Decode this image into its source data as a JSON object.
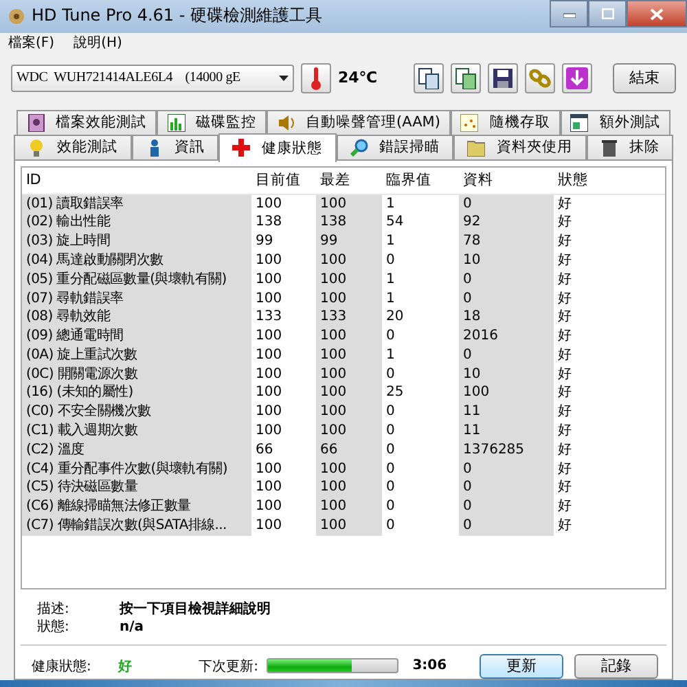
{
  "window": {
    "title": "HD Tune Pro 4.61 - 硬碟檢測維護工具"
  },
  "menu": [
    "檔案(F)",
    "說明(H)"
  ],
  "toolbar": {
    "drive": "WDC  WUH721414ALE6L4    (14000 gE",
    "temperature": "24℃",
    "exit_button": "結束"
  },
  "tab_rows": [
    [
      {
        "label": "檔案效能測試",
        "selected": false
      },
      {
        "label": "磁碟監控",
        "selected": false
      },
      {
        "label": "自動噪聲管理(AAM)",
        "selected": false
      },
      {
        "label": "隨機存取",
        "selected": false
      },
      {
        "label": "額外測試",
        "selected": false
      }
    ],
    [
      {
        "label": "效能測試",
        "selected": false
      },
      {
        "label": "資訊",
        "selected": false
      },
      {
        "label": "健康狀態",
        "selected": true
      },
      {
        "label": "錯誤掃瞄",
        "selected": false
      },
      {
        "label": "資料夾使用",
        "selected": false
      },
      {
        "label": "抹除",
        "selected": false
      }
    ]
  ],
  "table": {
    "columns": [
      "ID",
      "目前值",
      "最差",
      "臨界值",
      "資料",
      "狀態"
    ],
    "rows": [
      [
        "(01) 讀取錯誤率",
        "100",
        "100",
        "1",
        "0",
        "好"
      ],
      [
        "(02) 輸出性能",
        "138",
        "138",
        "54",
        "92",
        "好"
      ],
      [
        "(03) 旋上時間",
        "99",
        "99",
        "1",
        "78",
        "好"
      ],
      [
        "(04) 馬達啟動關閉次數",
        "100",
        "100",
        "0",
        "10",
        "好"
      ],
      [
        "(05) 重分配磁區數量(與壞軌有關)",
        "100",
        "100",
        "1",
        "0",
        "好"
      ],
      [
        "(07) 尋軌錯誤率",
        "100",
        "100",
        "1",
        "0",
        "好"
      ],
      [
        "(08) 尋軌效能",
        "133",
        "133",
        "20",
        "18",
        "好"
      ],
      [
        "(09) 總通電時間",
        "100",
        "100",
        "0",
        "2016",
        "好"
      ],
      [
        "(0A) 旋上重試次數",
        "100",
        "100",
        "1",
        "0",
        "好"
      ],
      [
        "(0C) 開關電源次數",
        "100",
        "100",
        "0",
        "10",
        "好"
      ],
      [
        "(16) (未知的屬性)",
        "100",
        "100",
        "25",
        "100",
        "好"
      ],
      [
        "(C0) 不安全關機次數",
        "100",
        "100",
        "0",
        "11",
        "好"
      ],
      [
        "(C1) 載入週期次數",
        "100",
        "100",
        "0",
        "11",
        "好"
      ],
      [
        "(C2) 溫度",
        "66",
        "66",
        "0",
        "1376285",
        "好"
      ],
      [
        "(C4) 重分配事件次數(與壞軌有關)",
        "100",
        "100",
        "0",
        "0",
        "好"
      ],
      [
        "(C5) 待決磁區數量",
        "100",
        "100",
        "0",
        "0",
        "好"
      ],
      [
        "(C6) 離線掃瞄無法修正數量",
        "100",
        "100",
        "0",
        "0",
        "好"
      ],
      [
        "(C7) 傳輸錯誤次數(與SATA排線...",
        "100",
        "100",
        "0",
        "0",
        "好"
      ]
    ]
  },
  "details": {
    "description_label": "描述:",
    "description": "按一下項目檢視詳細說明",
    "status_label": "狀態:",
    "status": "n/a"
  },
  "footer": {
    "health_label": "健康狀態:",
    "health": "好",
    "next_update_label": "下次更新:",
    "progress": {
      "level": 0.65
    },
    "time": "3:06",
    "refresh_button": "更新",
    "log_button": "記錄"
  }
}
